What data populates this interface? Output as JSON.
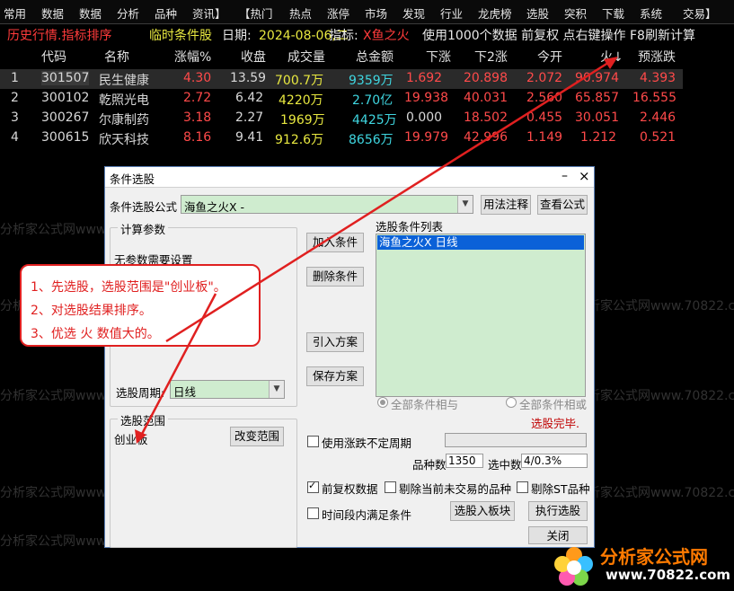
{
  "menu": [
    "常用",
    "数据",
    "数据",
    "分析",
    "品种",
    "资讯】",
    "【热门",
    "热点",
    "涨停",
    "市场",
    "发现",
    "行业",
    "龙虎榜",
    "选股",
    "突积",
    "下载",
    "系统",
    "交易】"
  ],
  "infobar": {
    "mode": "历史行情.指标排序",
    "temp": "临时条件股",
    "date_label": "日期:",
    "date": "2024-08-06,二",
    "ind_label": "指标:",
    "indicator": "X鱼之火",
    "hint": "使用1000个数据 前复权 点右键操作 F8刷新计算"
  },
  "table": {
    "headers": [
      "代码",
      "名称",
      "涨幅%",
      "收盘",
      "成交量",
      "总金额",
      "下涨",
      "下2涨",
      "今开",
      "火↓",
      "预涨跌"
    ],
    "rows": [
      {
        "idx": "1",
        "code": "301507",
        "name": "民生健康",
        "chg": "4.30",
        "close": "13.59",
        "vol": "700.7万",
        "amt": "9359万",
        "d1": "1.692",
        "d2": "20.898",
        "open": "2.072",
        "fire": "90.974",
        "pred": "4.393"
      },
      {
        "idx": "2",
        "code": "300102",
        "name": "乾照光电",
        "chg": "2.72",
        "close": "6.42",
        "vol": "4220万",
        "amt": "2.70亿",
        "d1": "19.938",
        "d2": "40.031",
        "open": "2.560",
        "fire": "65.857",
        "pred": "16.555"
      },
      {
        "idx": "3",
        "code": "300267",
        "name": "尔康制药",
        "chg": "3.18",
        "close": "2.27",
        "vol": "1969万",
        "amt": "4425万",
        "d1": "0.000",
        "d2": "18.502",
        "open": "0.455",
        "fire": "30.051",
        "pred": "2.446"
      },
      {
        "idx": "4",
        "code": "300615",
        "name": "欣天科技",
        "chg": "8.16",
        "close": "9.41",
        "vol": "912.6万",
        "amt": "8656万",
        "d1": "19.979",
        "d2": "42.996",
        "open": "1.149",
        "fire": "1.212",
        "pred": "0.521"
      }
    ]
  },
  "watermark": "分析家公式网www.70822.com",
  "dialog": {
    "title": "条件选股",
    "formula_label": "条件选股公式",
    "formula_value": "海鱼之火X    -",
    "usage_btn": "用法注释",
    "view_btn": "查看公式",
    "calc_group": "计算参数",
    "no_param": "无参数需要设置",
    "add_btn": "加入条件",
    "del_btn": "删除条件",
    "import_btn": "引入方案",
    "save_btn": "保存方案",
    "list_label": "选股条件列表",
    "list_item": "海鱼之火X    日线",
    "period_label": "选股周期:",
    "period_value": "日线",
    "radio_and": "全部条件相与",
    "radio_or": "全部条件相或",
    "done": "选股完毕.",
    "range_group": "选股范围",
    "range_value": "创业板",
    "change_range_btn": "改变范围",
    "use_period_chk": "使用涨跌不定周期",
    "count_label": "品种数",
    "count_value": "1350",
    "selected_label": "选中数",
    "selected_value": "4/0.3%",
    "adj_chk": "前复权数据",
    "exclude_chk": "剔除当前未交易的品种",
    "st_chk": "剔除ST品种",
    "period_cond_chk": "时间段内满足条件",
    "to_block_btn": "选股入板块",
    "run_btn": "执行选股",
    "close_btn": "关闭"
  },
  "note": [
    "1、先选股，选股范围是\"创业板\"。",
    "2、对选股结果排序。",
    "3、优选 火 数值大的。"
  ],
  "logo": {
    "name": "分析家公式网",
    "url": "www.70822.com"
  },
  "colors": {
    "red": "#ff3b3b",
    "yellow": "#e8e840",
    "cyan": "#3fd6e0",
    "annotation": "#e02020",
    "selection": "#0b61d8"
  }
}
